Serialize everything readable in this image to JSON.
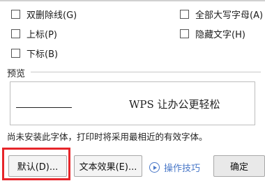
{
  "effects": {
    "left_column": [
      {
        "label": "双删除线(G)",
        "checked": false
      },
      {
        "label": "上标(P)",
        "checked": false
      },
      {
        "label": "下标(B)",
        "checked": false
      }
    ],
    "right_column": [
      {
        "label": "全部大写字母(A)",
        "checked": false
      },
      {
        "label": "隐藏文字(H)",
        "checked": false
      }
    ]
  },
  "preview": {
    "section_title": "预览",
    "sample_text": "WPS 让办公更轻松",
    "font_note": "尚未安装此字体，打印时将采用最相近的有效字体。"
  },
  "buttons": {
    "default": "默认(D)...",
    "text_effects": "文本效果(E)...",
    "tips": "操作技巧",
    "ok": "确定"
  },
  "colors": {
    "highlight_border": "#e6252a",
    "tips_link": "#4a78c8"
  }
}
